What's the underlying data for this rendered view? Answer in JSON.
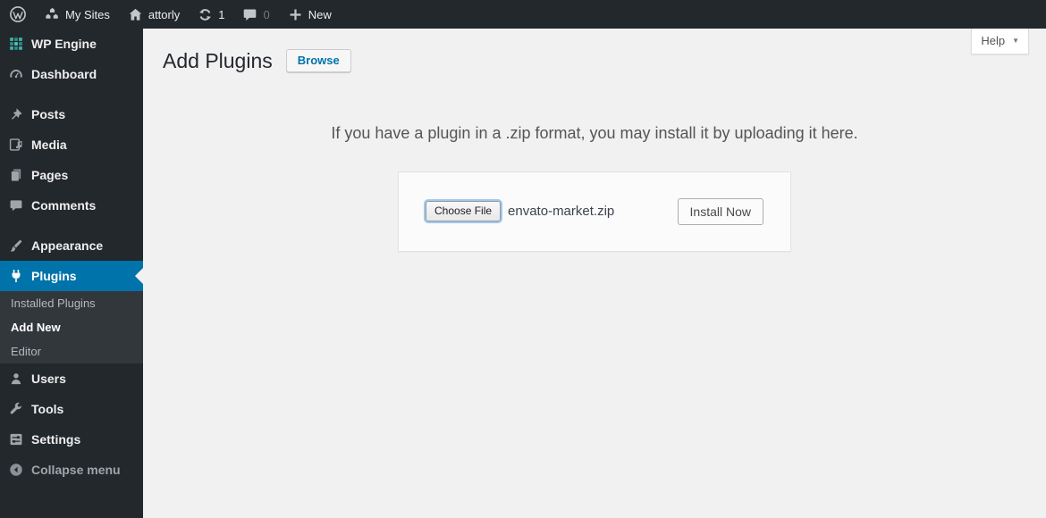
{
  "admin_bar": {
    "my_sites_label": "My Sites",
    "site_name": "attorly",
    "update_count": "1",
    "comment_count": "0",
    "new_label": "New"
  },
  "sidebar": {
    "items": [
      {
        "label": "WP Engine"
      },
      {
        "label": "Dashboard"
      },
      {
        "label": "Posts"
      },
      {
        "label": "Media"
      },
      {
        "label": "Pages"
      },
      {
        "label": "Comments"
      },
      {
        "label": "Appearance"
      },
      {
        "label": "Plugins"
      },
      {
        "label": "Users"
      },
      {
        "label": "Tools"
      },
      {
        "label": "Settings"
      },
      {
        "label": "Collapse menu"
      }
    ],
    "plugins_submenu": [
      {
        "label": "Installed Plugins"
      },
      {
        "label": "Add New",
        "active": true
      },
      {
        "label": "Editor"
      }
    ]
  },
  "header": {
    "title": "Add Plugins",
    "browse_label": "Browse",
    "help_label": "Help",
    "help_caret": "▼"
  },
  "main": {
    "install_help": "If you have a plugin in a .zip format, you may install it by uploading it here.",
    "choose_file_label": "Choose File",
    "file_name": "envato-market.zip",
    "install_button_label": "Install Now"
  },
  "colors": {
    "admin_bar_bg": "#23282d",
    "sidebar_bg": "#23282d",
    "submenu_bg": "#32373c",
    "active_menu_blue": "#0073aa",
    "link_blue": "#0073aa",
    "body_bg": "#f1f1f1",
    "wp_engine_teal": "#3fb5ad",
    "focus_ring_blue": "#a3c8ec"
  }
}
